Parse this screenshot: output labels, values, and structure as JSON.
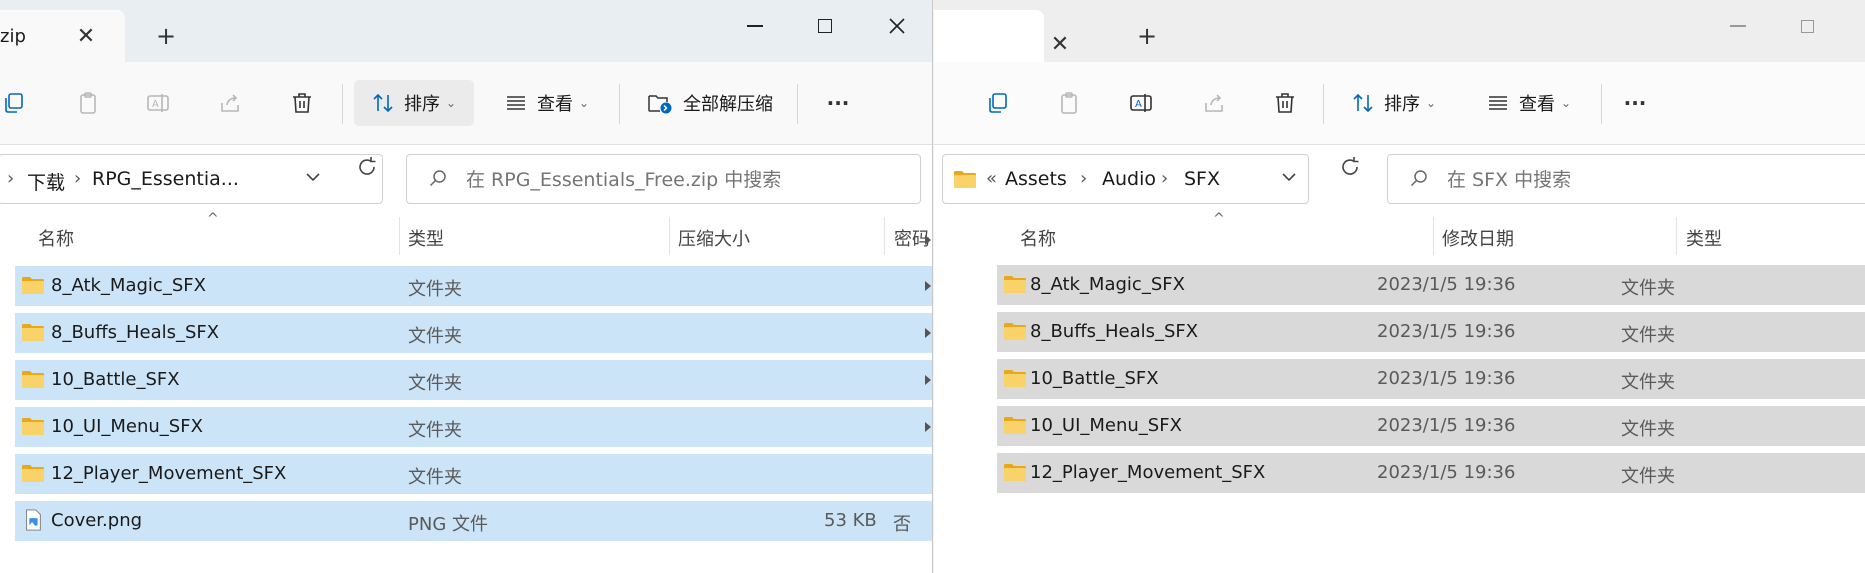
{
  "left_window": {
    "tab_title": "zip",
    "toolbar": {
      "sort_label": "排序",
      "view_label": "查看",
      "extract_all_label": "全部解压缩",
      "more_label": "···"
    },
    "breadcrumb": [
      "下载",
      "RPG_Essentia..."
    ],
    "breadcrumb_leading_sep": "›",
    "search_placeholder": "在 RPG_Essentials_Free.zip 中搜索",
    "columns": [
      "名称",
      "类型",
      "压缩大小",
      "密码"
    ],
    "rows": [
      {
        "name": "8_Atk_Magic_SFX",
        "type": "文件夹",
        "size": "",
        "password": "",
        "icon": "folder-icon"
      },
      {
        "name": "8_Buffs_Heals_SFX",
        "type": "文件夹",
        "size": "",
        "password": "",
        "icon": "folder-icon"
      },
      {
        "name": "10_Battle_SFX",
        "type": "文件夹",
        "size": "",
        "password": "",
        "icon": "folder-icon"
      },
      {
        "name": "10_UI_Menu_SFX",
        "type": "文件夹",
        "size": "",
        "password": "",
        "icon": "folder-icon"
      },
      {
        "name": "12_Player_Movement_SFX",
        "type": "文件夹",
        "size": "",
        "password": "",
        "icon": "folder-icon"
      },
      {
        "name": "Cover.png",
        "type": "PNG 文件",
        "size": "53 KB",
        "password": "否",
        "icon": "png-file-icon"
      }
    ]
  },
  "right_window": {
    "toolbar": {
      "sort_label": "排序",
      "view_label": "查看",
      "more_label": "···"
    },
    "breadcrumb_overflow": "«",
    "breadcrumb": [
      "Assets",
      "Audio",
      "SFX"
    ],
    "search_placeholder": "在 SFX 中搜索",
    "columns": [
      "名称",
      "修改日期",
      "类型"
    ],
    "rows": [
      {
        "name": "8_Atk_Magic_SFX",
        "date": "2023/1/5 19:36",
        "type": "文件夹",
        "icon": "folder-icon"
      },
      {
        "name": "8_Buffs_Heals_SFX",
        "date": "2023/1/5 19:36",
        "type": "文件夹",
        "icon": "folder-icon"
      },
      {
        "name": "10_Battle_SFX",
        "date": "2023/1/5 19:36",
        "type": "文件夹",
        "icon": "folder-icon"
      },
      {
        "name": "10_UI_Menu_SFX",
        "date": "2023/1/5 19:36",
        "type": "文件夹",
        "icon": "folder-icon"
      },
      {
        "name": "12_Player_Movement_SFX",
        "date": "2023/1/5 19:36",
        "type": "文件夹",
        "icon": "folder-icon"
      }
    ]
  },
  "colors": {
    "selected_row": "#cce4f7",
    "inactive_selected_row": "#d9d9d9",
    "folder_yellow": "#f8c43a",
    "accent": "#0067c0"
  }
}
